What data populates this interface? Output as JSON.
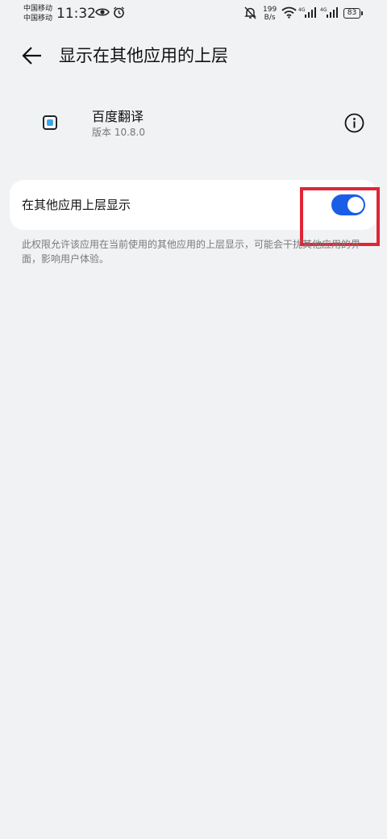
{
  "status_bar": {
    "carrier_1": "中国移动",
    "carrier_2": "中国移动",
    "time": "11:32",
    "net_speed_value": "199",
    "net_speed_unit": "B/s",
    "signal_1_label": "4G",
    "signal_2_label": "4G",
    "battery": "83",
    "icons": [
      "eye-icon",
      "alarm-icon",
      "mute-bell-icon",
      "wifi-icon",
      "signal-icon",
      "signal-icon",
      "battery-icon"
    ]
  },
  "header": {
    "title": "显示在其他应用的上层",
    "back_icon": "back-arrow-icon"
  },
  "app": {
    "name": "百度翻译",
    "version": "版本 10.8.0",
    "icon": "baidu-translate-icon",
    "info_icon": "info-icon"
  },
  "setting": {
    "label": "在其他应用上层显示",
    "enabled": true,
    "accent_color": "#1a5ee8"
  },
  "description": "此权限允许该应用在当前使用的其他应用的上层显示，可能会干扰其他应用的界面，影响用户体验。",
  "annotation": {
    "highlight_color": "#e02535"
  }
}
